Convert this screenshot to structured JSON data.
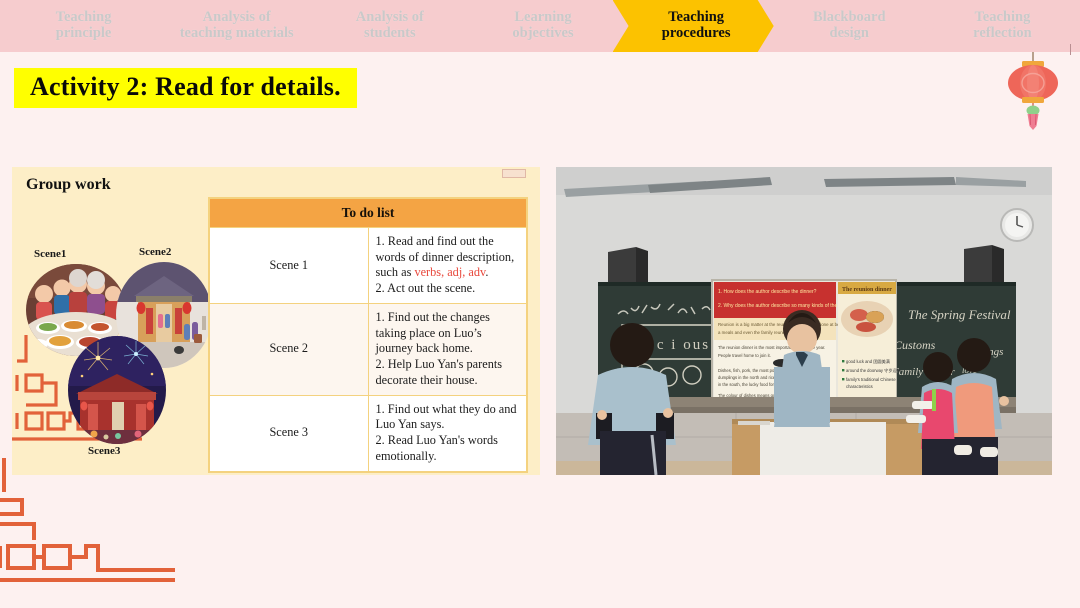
{
  "breadcrumb": {
    "steps": [
      {
        "label": "Teaching\nprinciple",
        "active": false
      },
      {
        "label": "Analysis of\nteaching materials",
        "active": false
      },
      {
        "label": "Analysis of\nstudents",
        "active": false
      },
      {
        "label": "Learning\nobjectives",
        "active": false
      },
      {
        "label": "Teaching\nprocedures",
        "active": true
      },
      {
        "label": "Blackboard\ndesign",
        "active": false
      },
      {
        "label": "Teaching\nreflection",
        "active": false
      }
    ],
    "colors": {
      "inactive_bg": "#f6ccce",
      "inactive_text": "#c9c9c9",
      "active_bg": "#fcc200",
      "active_text": "#111111"
    }
  },
  "title": {
    "text": "Activity 2: Read for details.",
    "highlight_color": "#ffff00"
  },
  "decorations": {
    "lantern_icon": "chinese-lantern-icon",
    "lantern_body_color": "#ee6659",
    "lantern_cap_color": "#f0a73c",
    "fret_color": "#e2623a",
    "page_background": "#fdf1f0"
  },
  "group_panel": {
    "heading": "Group work",
    "background": "#fdeec7",
    "collage": {
      "scenes": [
        {
          "label": "Scene1",
          "icon": "family-dinner-photo"
        },
        {
          "label": "Scene2",
          "icon": "courtyard-house-photo"
        },
        {
          "label": "Scene3",
          "icon": "fireworks-temple-photo"
        }
      ]
    },
    "todo_table": {
      "header": "To do list",
      "header_bg": "#f4a444",
      "border_color": "#f4d27f",
      "rows": [
        {
          "scene": "Scene 1",
          "tint": false,
          "tasks": [
            {
              "pre": "1. Read and  find out the words of dinner description, such as ",
              "highlight": "verbs, adj, adv",
              "post": "."
            },
            {
              "pre": "2. Act out the scene.",
              "highlight": "",
              "post": ""
            }
          ]
        },
        {
          "scene": "Scene 2",
          "tint": true,
          "tasks": [
            {
              "pre": "1. Find out the changes taking place on Luo’s journey back home.",
              "highlight": "",
              "post": ""
            },
            {
              "pre": "2. Help Luo Yan's parents decorate their house.",
              "highlight": "",
              "post": ""
            }
          ]
        },
        {
          "scene": "Scene 3",
          "tint": false,
          "tasks": [
            {
              "pre": "1. Find out what they do and Luo Yan says.",
              "highlight": "",
              "post": ""
            },
            {
              "pre": "2. Read Luo Yan's words emotionally.",
              "highlight": "",
              "post": ""
            }
          ]
        }
      ]
    }
  },
  "classroom_photo": {
    "alt": "classroom-group-work-photo",
    "blackboard_text_left": "U1 Extended Reading",
    "blackboard_word": "precious",
    "blackboard_text_right_title": "The Spring Festival",
    "blackboard_text_right_items": [
      "Customs",
      "Meanings",
      "Family dinner"
    ],
    "screen_title": "The reunion dinner"
  }
}
